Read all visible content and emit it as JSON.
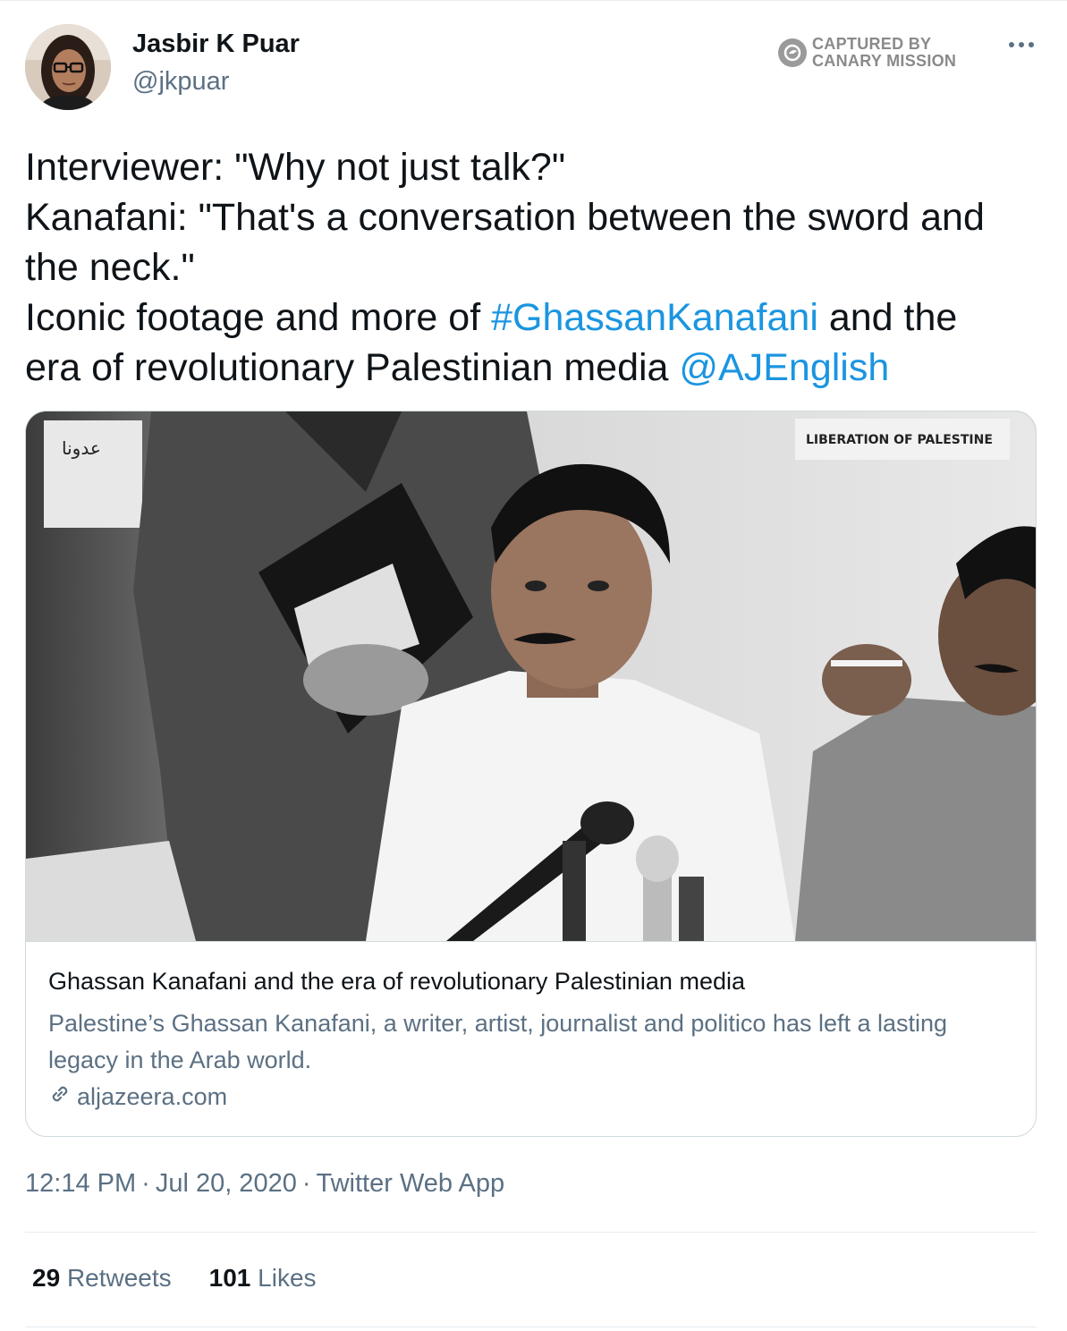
{
  "author": {
    "name": "Jasbir K Puar",
    "handle": "@jkpuar"
  },
  "watermark": {
    "line1": "CAPTURED BY",
    "line2": "CANARY MISSION"
  },
  "tweet": {
    "line1": "Interviewer: \"Why not just talk?\"",
    "line2": "Kanafani: \"That's a conversation between the sword and",
    "line3": "the neck.\"",
    "line4_prefix": "Iconic footage and more of ",
    "hashtag": "#GhassanKanafani",
    "line4_suffix": " and the",
    "line5_prefix": "era of revolutionary Palestinian media ",
    "mention": "@AJEnglish"
  },
  "card": {
    "image_signs": {
      "arabic": "عدونا",
      "banner": "LIBERATION OF PALESTINE"
    },
    "title": "Ghassan Kanafani and the era of revolutionary Palestinian media",
    "description": "Palestine’s Ghassan Kanafani, a writer, artist, journalist and politico has left a lasting legacy in the Arab world.",
    "domain": "aljazeera.com"
  },
  "meta": {
    "time": "12:14 PM",
    "date": "Jul 20, 2020",
    "source": "Twitter Web App"
  },
  "stats": {
    "retweets_count": "29",
    "retweets_label": "Retweets",
    "likes_count": "101",
    "likes_label": "Likes"
  },
  "icons": [
    "avatar",
    "canary-mission-logo-icon",
    "more-icon",
    "link-icon"
  ],
  "colors": {
    "link": "#1b95e0",
    "secondary_text": "#5b7083",
    "primary_text": "#0f1419",
    "border": "#cfd9de"
  }
}
